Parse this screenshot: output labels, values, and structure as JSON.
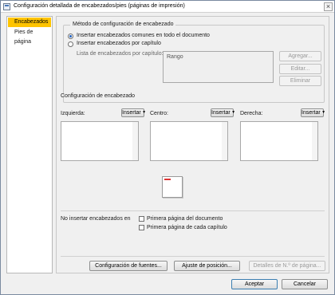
{
  "window": {
    "title": "Configuración detallada de encabezados/pies (páginas de impresión)"
  },
  "sidebar": {
    "items": [
      {
        "label": "Encabezados",
        "active": true
      },
      {
        "label": "Pies de página",
        "active": false
      }
    ]
  },
  "method_group": {
    "title": "Método de configuración de encabezado",
    "option_common": "Insertar encabezados comunes en todo el documento",
    "option_per_chapter": "Insertar encabezados por capítulo",
    "list_label": "Lista de encabezados por capítulo:",
    "list_value": "Rango",
    "add": "Agregar...",
    "edit": "Editar...",
    "delete": "Eliminar"
  },
  "header_config": {
    "title": "Configuración de encabezado",
    "left_label": "Izquierda:",
    "center_label": "Centro:",
    "right_label": "Derecha:",
    "insert": "Insertar"
  },
  "no_insert": {
    "label": "No insertar encabezados en",
    "first_doc": "Primera página del documento",
    "first_chapter": "Primera página de cada capítulo"
  },
  "bottom_buttons": {
    "fonts": "Configuración de fuentes...",
    "position": "Ajuste de posición...",
    "page_details": "Detalles de N.º de página..."
  },
  "footer": {
    "accept": "Aceptar",
    "cancel": "Cancelar"
  }
}
